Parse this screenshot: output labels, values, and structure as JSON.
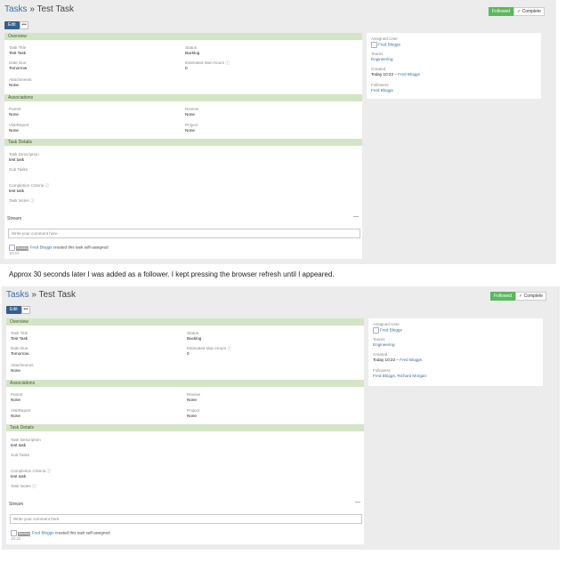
{
  "caption": "Approx 30 seconds later I was added as a follower.  I kept pressing the browser refresh until I appeared.",
  "shots": [
    {
      "breadcrumb": {
        "link": "Tasks",
        "sep": " » ",
        "title": "Test Task"
      },
      "toolbar": {
        "edit_label": "Edit",
        "more_label": "•••",
        "followed_label": "Followed",
        "complete_label": "✓ Complete"
      },
      "overview": {
        "header": "Overview",
        "task_title_label": "Task Title",
        "task_title": "Test Task",
        "status_label": "Status",
        "status": "Backlog",
        "date_due_label": "Date Due",
        "date_due": "Tomorrow",
        "est_hours_label": "Estimated Man Hours ⓘ",
        "est_hours": "0",
        "attachments_label": "Attachments",
        "attachments": "None"
      },
      "associations": {
        "header": "Associations",
        "parent_label": "Parent",
        "parent": "None",
        "review_label": "Review",
        "review": "None",
        "visit_label": "VisitReport",
        "visit": "None",
        "project_label": "Project",
        "project": "None"
      },
      "details": {
        "header": "Task Details",
        "desc_label": "Task Description",
        "desc": "test task",
        "subtasks_label": "Sub Tasks",
        "criteria_label": "Completion Criteria ⓘ",
        "criteria": "test task",
        "notes_label": "Task Notes ⓘ"
      },
      "stream": {
        "title": "Stream",
        "collapse": "—",
        "placeholder": "Write your comment here",
        "badge": "Backlog",
        "who": "Fred Bloggs",
        "action": " created this task self-assigned",
        "time": "10:22"
      },
      "sidebar": {
        "assigned_label": "Assigned User",
        "assigned": "Fred Bloggs",
        "teams_label": "Teams",
        "teams": "Engineering",
        "created_label": "Created",
        "created_time": "Today 10:22 – ",
        "created_by": "Fred Bloggs",
        "followers_label": "Followers",
        "followers": "Fred Bloggs"
      }
    },
    {
      "breadcrumb": {
        "link": "Tasks",
        "sep": " » ",
        "title": "Test Task"
      },
      "toolbar": {
        "edit_label": "Edit",
        "more_label": "•••",
        "followed_label": "Followed",
        "complete_label": "✓ Complete"
      },
      "overview": {
        "header": "Overview",
        "task_title_label": "Task Title",
        "task_title": "Test Task",
        "status_label": "Status",
        "status": "Backlog",
        "date_due_label": "Date Due",
        "date_due": "Tomorrow",
        "est_hours_label": "Estimated Man Hours ⓘ",
        "est_hours": "0",
        "attachments_label": "Attachments",
        "attachments": "None"
      },
      "associations": {
        "header": "Associations",
        "parent_label": "Parent",
        "parent": "None",
        "review_label": "Review",
        "review": "None",
        "visit_label": "VisitReport",
        "visit": "None",
        "project_label": "Project",
        "project": "None"
      },
      "details": {
        "header": "Task Details",
        "desc_label": "Task Description",
        "desc": "test task",
        "subtasks_label": "Sub Tasks",
        "criteria_label": "Completion Criteria ⓘ",
        "criteria": "test task",
        "notes_label": "Task Notes ⓘ"
      },
      "stream": {
        "title": "Stream",
        "collapse": "—",
        "placeholder": "Write your comment here",
        "badge": "Backlog",
        "who": "Fred Bloggs",
        "action": " created this task self-assigned",
        "time": "10:22"
      },
      "sidebar": {
        "assigned_label": "Assigned User",
        "assigned": "Fred Bloggs",
        "teams_label": "Teams",
        "teams": "Engineering",
        "created_label": "Created",
        "created_time": "Today 10:22 – ",
        "created_by": "Fred Bloggs",
        "followers_label": "Followers",
        "followers": "Fred Bloggs, Richard Morgan"
      }
    }
  ]
}
